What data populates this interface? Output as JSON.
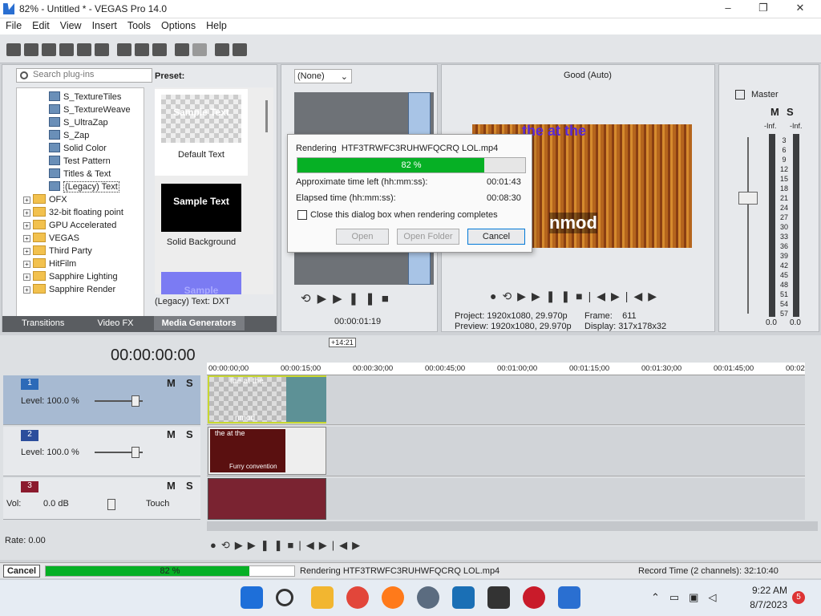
{
  "window": {
    "title": "82% - Untitled * - VEGAS Pro 14.0",
    "min": "–",
    "max": "❐",
    "close": "✕"
  },
  "menu": [
    "File",
    "Edit",
    "View",
    "Insert",
    "Tools",
    "Options",
    "Help"
  ],
  "explorer": {
    "search_placeholder": "Search plug-ins",
    "preset_label": "Preset:",
    "items": [
      {
        "label": "S_TextureTiles",
        "type": "plugin"
      },
      {
        "label": "S_TextureWeave",
        "type": "plugin"
      },
      {
        "label": "S_UltraZap",
        "type": "plugin"
      },
      {
        "label": "S_Zap",
        "type": "plugin"
      },
      {
        "label": "Solid Color",
        "type": "plugin"
      },
      {
        "label": "Test Pattern",
        "type": "plugin"
      },
      {
        "label": "Titles & Text",
        "type": "plugin"
      },
      {
        "label": "(Legacy) Text",
        "type": "plugin",
        "selected": true
      },
      {
        "label": "OFX",
        "type": "folder"
      },
      {
        "label": "32-bit floating point",
        "type": "folder"
      },
      {
        "label": "GPU Accelerated",
        "type": "folder"
      },
      {
        "label": "VEGAS",
        "type": "folder"
      },
      {
        "label": "Third Party",
        "type": "folder"
      },
      {
        "label": "HitFilm",
        "type": "folder"
      },
      {
        "label": "Sapphire Lighting",
        "type": "folder"
      },
      {
        "label": "Sapphire Render",
        "type": "folder"
      }
    ],
    "presets": [
      {
        "thumb": "Sample Text",
        "label": "Default Text"
      },
      {
        "thumb": "Sample Text",
        "label": "Solid Background"
      },
      {
        "thumb": "Sample",
        "label": ""
      }
    ],
    "status": "(Legacy) Text: DXT",
    "tabs": [
      "Transitions",
      "Video FX",
      "Media Generators"
    ]
  },
  "trimmer": {
    "dropdown": "(None)",
    "timecode": "00:00:01:19"
  },
  "preview": {
    "quality": "Good (Auto)",
    "project_label": "Project:",
    "project": "1920x1080, 29.970p",
    "preview_label": "Preview:",
    "preview_val": "1920x1080, 29.970p",
    "frame_label": "Frame:",
    "frame": "611",
    "display_label": "Display:",
    "display": "317x178x32",
    "overlay_text1": "the at the",
    "overlay_text2": "nmod"
  },
  "mixer": {
    "title": "Master",
    "m": "M",
    "s": "S",
    "inf": "-Inf.",
    "scale": [
      "3",
      "6",
      "9",
      "12",
      "15",
      "18",
      "21",
      "24",
      "27",
      "30",
      "33",
      "36",
      "39",
      "42",
      "45",
      "48",
      "51",
      "54",
      "57"
    ],
    "bottom": "0.0"
  },
  "dialog": {
    "rendering_label": "Rendering",
    "file": "HTF3TRWFC3RUHWFQCRQ LOL.mp4",
    "progress_text": "82 %",
    "progress": 0.82,
    "time_left_label": "Approximate time left (hh:mm:ss):",
    "time_left": "00:01:43",
    "elapsed_label": "Elapsed time (hh:mm:ss):",
    "elapsed": "00:08:30",
    "checkbox_label": "Close this dialog box when rendering completes",
    "open": "Open",
    "open_folder": "Open Folder",
    "cancel": "Cancel"
  },
  "timeline": {
    "timecode": "00:00:00:00",
    "offset": "+14:21",
    "ruler": [
      "00:00:00;00",
      "00:00:15;00",
      "00:00:30;00",
      "00:00:45;00",
      "00:01:00;00",
      "00:01:15;00",
      "00:01:30;00",
      "00:01:45;00",
      "00:02"
    ],
    "tracks": [
      {
        "num": "1",
        "level": "Level: 100.0 %",
        "m": "M",
        "s": "S",
        "clip_text1": "the at the",
        "clip_text2": "nmod"
      },
      {
        "num": "2",
        "level": "Level: 100.0 %",
        "m": "M",
        "s": "S",
        "clip_text1": "the at the",
        "clip_text2": "Furry convention"
      },
      {
        "num": "3",
        "vol_label": "Vol:",
        "vol": "0.0 dB",
        "touch": "Touch",
        "m": "M",
        "s": "S"
      }
    ],
    "rate": "Rate: 0.00"
  },
  "statusbar": {
    "cancel": "Cancel",
    "progress_text": "82 %",
    "progress": 0.82,
    "rendering": "Rendering  HTF3TRWFC3RUHWFQCRQ LOL.mp4",
    "record_time": "Record Time (2 channels): 32:10:40"
  },
  "taskbar": {
    "time": "9:22 AM",
    "date": "8/7/2023",
    "badge": "5"
  }
}
